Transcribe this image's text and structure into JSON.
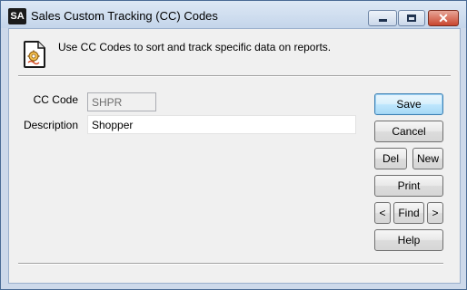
{
  "window": {
    "app_badge": "SA",
    "title": "Sales Custom Tracking (CC) Codes",
    "controls": {
      "minimize_icon": "minimize-icon",
      "maximize_icon": "maximize-icon",
      "close_icon": "close-icon",
      "close_glyph": "✕"
    }
  },
  "header": {
    "icon": "document-gear-icon",
    "text": "Use CC Codes to sort and track specific data on reports."
  },
  "form": {
    "cc_code": {
      "label": "CC Code",
      "value": "SHPR"
    },
    "description": {
      "label": "Description",
      "value": "Shopper"
    }
  },
  "buttons": {
    "save": "Save",
    "cancel": "Cancel",
    "del": "Del",
    "new": "New",
    "print": "Print",
    "prev": "<",
    "find": "Find",
    "next": ">",
    "help": "Help"
  },
  "colors": {
    "close_button": "#c9462e",
    "window_frame": "#cdd9ea",
    "default_button_border": "#3c7fb1"
  }
}
